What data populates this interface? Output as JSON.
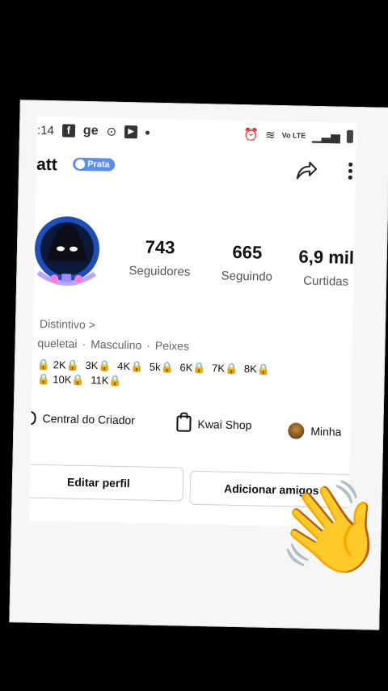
{
  "status_bar": {
    "time": ":14",
    "fb_icon": "f",
    "app_text": "ge",
    "lte_label": "Vo LTE"
  },
  "profile": {
    "username": "att",
    "badge_label": "Prata"
  },
  "stats": [
    {
      "value": "743",
      "label": "Seguidores"
    },
    {
      "value": "665",
      "label": "Seguindo"
    },
    {
      "value": "6,9 mil",
      "label": "Curtidas"
    }
  ],
  "distintivo_label": "Distintivo >",
  "meta": {
    "handle": "queletai",
    "gender": "Masculino",
    "sign": "Peixes"
  },
  "milestones": [
    "🔒 2K🔒",
    "3K🔒",
    "4K🔒",
    "5k🔒",
    "6K🔒",
    "7K🔒",
    "8K🔒",
    "🔒 10K🔒",
    "11K🔒"
  ],
  "links": {
    "creator_center": "Central do Criador",
    "kwai_shop": "Kwai Shop",
    "minha": "Minha"
  },
  "buttons": {
    "edit_profile": "Editar perfil",
    "add_friends": "Adicionar amigos"
  },
  "colors": {
    "badge": "#5a8dee",
    "avatar_ring": "#2a7cf0",
    "hand": "#ffcc33"
  }
}
